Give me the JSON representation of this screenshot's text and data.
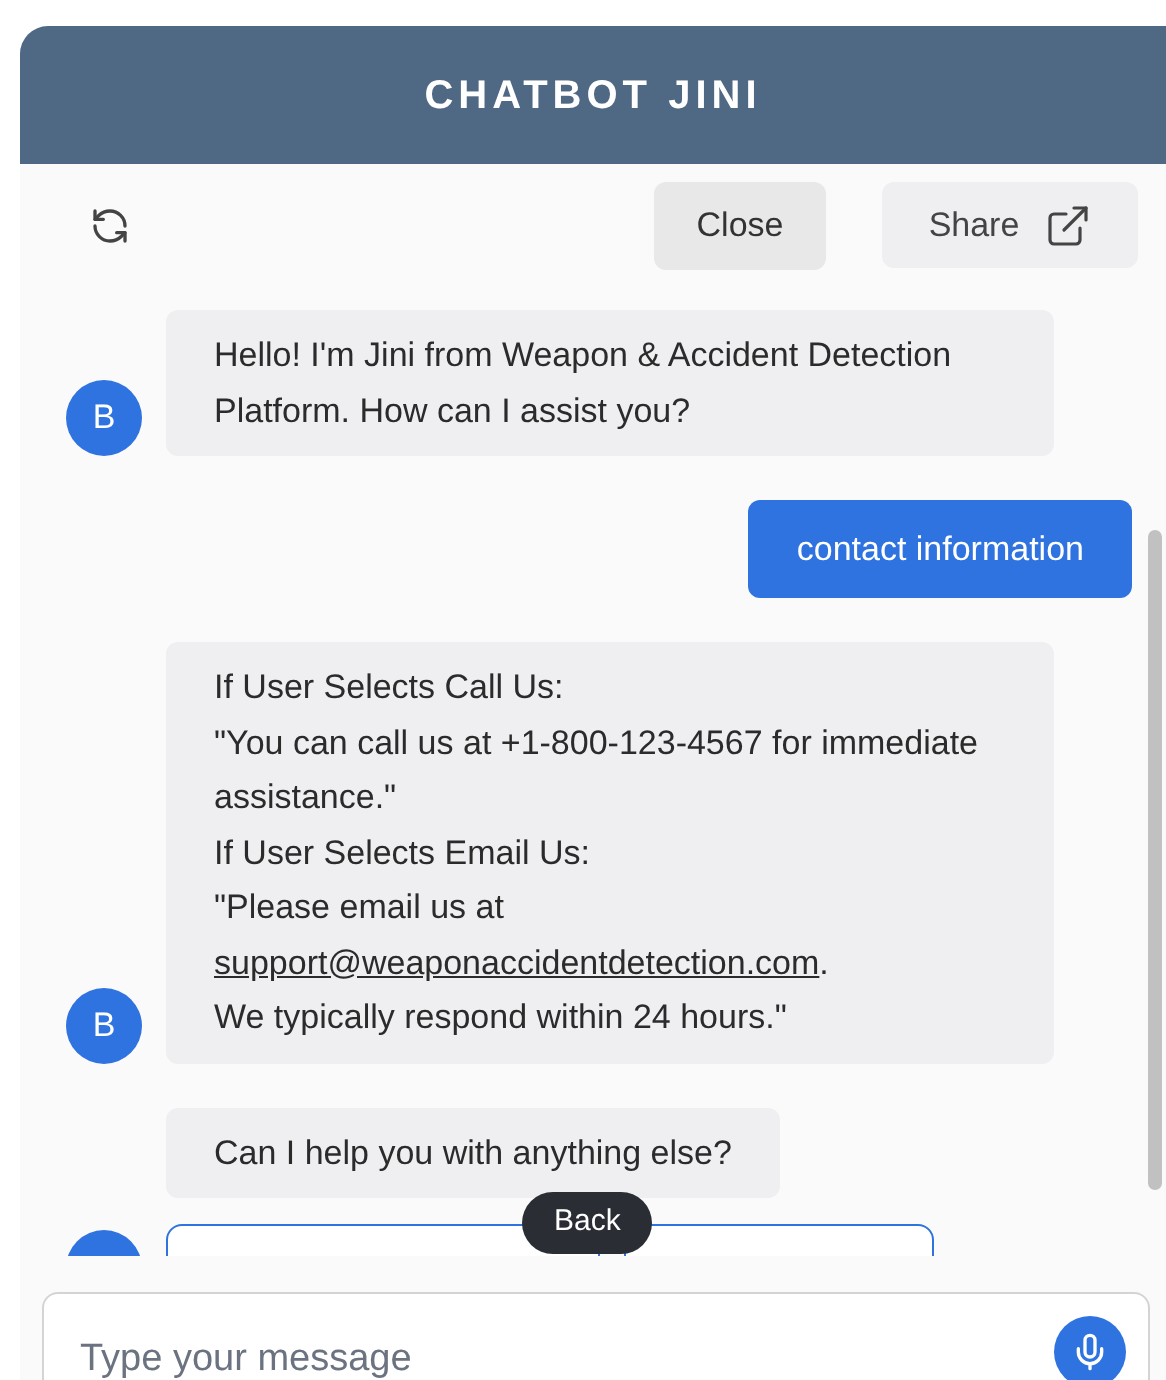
{
  "header": {
    "title": "CHATBOT JINI"
  },
  "toolbar": {
    "close_label": "Close",
    "share_label": "Share"
  },
  "messages": [
    {
      "kind": "bot",
      "avatar": "B",
      "lines": [
        {
          "kind": "text",
          "text": "Hello! I'm Jini from Weapon & Accident Detection Platform. How can I assist you?"
        }
      ]
    },
    {
      "kind": "user",
      "text": "contact information"
    },
    {
      "kind": "bot",
      "avatar": "B",
      "lines": [
        {
          "kind": "text",
          "text": "If User Selects Call Us:"
        },
        {
          "kind": "text",
          "text": "\"You can call us at +1-800-123-4567 for immediate assistance.\""
        },
        {
          "kind": "text",
          "text": "If User Selects Email Us:"
        },
        {
          "kind": "text",
          "text": "\"Please email us at"
        },
        {
          "kind": "link",
          "text": "support@weaponaccidentdetection.com",
          "after": "."
        },
        {
          "kind": "text",
          "text": "We typically respond within 24 hours.\""
        }
      ]
    },
    {
      "kind": "bot",
      "lines": [
        {
          "kind": "text",
          "text": "Can I help you with anything else?"
        }
      ]
    }
  ],
  "tooltip": {
    "text": "Back"
  },
  "composer": {
    "placeholder": "Type your message"
  }
}
